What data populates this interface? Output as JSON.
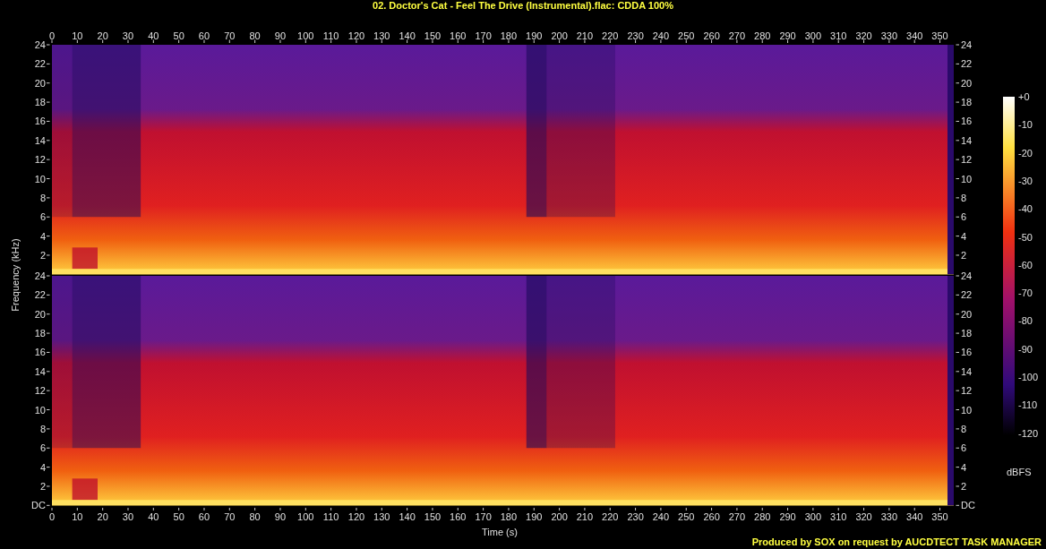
{
  "title": "02. Doctor's Cat - Feel The Drive (Instrumental).flac: CDDA 100%",
  "x_axis": {
    "label": "Time (s)",
    "top_ticks": [
      "0",
      "10",
      "20",
      "30",
      "40",
      "50",
      "60",
      "70",
      "80",
      "90",
      "100",
      "110",
      "120",
      "130",
      "140",
      "150",
      "160",
      "170",
      "180",
      "190",
      "200",
      "210",
      "220",
      "230",
      "240",
      "250",
      "260",
      "270",
      "280",
      "290",
      "300",
      "310",
      "320",
      "330",
      "340",
      "350"
    ],
    "bottom_ticks": [
      "0",
      "10",
      "20",
      "30",
      "40",
      "50",
      "60",
      "70",
      "80",
      "90",
      "100",
      "110",
      "120",
      "130",
      "140",
      "150",
      "160",
      "170",
      "180",
      "190",
      "200",
      "210",
      "220",
      "230",
      "240",
      "250",
      "260",
      "270",
      "280",
      "290",
      "300",
      "310",
      "320",
      "330",
      "340",
      "350"
    ]
  },
  "y_axis": {
    "label": "Frequency (kHz)",
    "channels": [
      {
        "left_ticks": [
          "24",
          "22",
          "20",
          "18",
          "16",
          "14",
          "12",
          "10",
          "8",
          "6",
          "4",
          "2"
        ],
        "right_ticks": [
          "24",
          "22",
          "20",
          "18",
          "16",
          "14",
          "12",
          "10",
          "8",
          "6",
          "4",
          "2"
        ]
      },
      {
        "left_ticks": [
          "24",
          "22",
          "20",
          "18",
          "16",
          "14",
          "12",
          "10",
          "8",
          "6",
          "4",
          "2",
          "DC"
        ],
        "right_ticks": [
          "24",
          "22",
          "20",
          "18",
          "16",
          "14",
          "12",
          "10",
          "8",
          "6",
          "4",
          "2",
          "DC"
        ]
      }
    ]
  },
  "colorbar": {
    "label": "dBFS",
    "ticks": [
      "+0",
      "-10",
      "-20",
      "-30",
      "-40",
      "-50",
      "-60",
      "-70",
      "-80",
      "-90",
      "-100",
      "-110",
      "-120"
    ]
  },
  "footer": "Produced by SOX on request by AUCDTECT TASK MANAGER"
}
